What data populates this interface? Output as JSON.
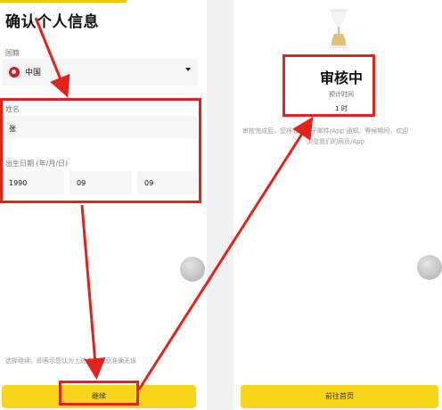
{
  "left": {
    "title": "确认个人信息",
    "nationality_label": "国籍",
    "nationality_value": "中国",
    "name_label": "姓名",
    "name_value": "张",
    "dob_label": "出生日期 (年/月/日)",
    "dob_year": "1990",
    "dob_month": "09",
    "dob_day": "09",
    "consent_text": "选择继续，即表示您认为上述个人信息准确无误",
    "continue_label": "继续"
  },
  "right": {
    "status_title": "审核中",
    "eta_label": "预计时间",
    "eta_value": "1 时",
    "desc_line1": "审核完成后，您将收到电子邮件/App 通知。等候期间，欢迎",
    "desc_line2": "浏览我们的网页/App",
    "home_label": "前往首页"
  },
  "colors": {
    "accent_yellow": "#f7d51b",
    "annotation_red": "#e3231b"
  }
}
